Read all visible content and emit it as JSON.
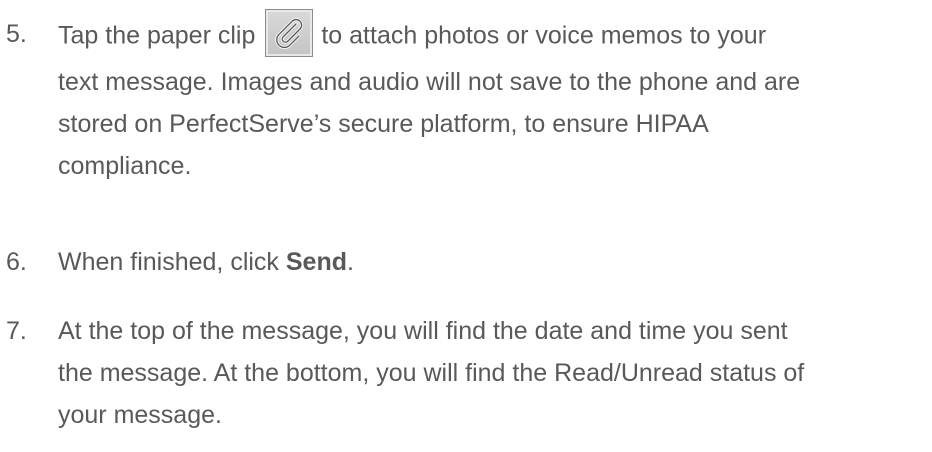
{
  "steps": [
    {
      "number": "5.",
      "pre_icon": "Tap the paper clip",
      "icon": "paperclip-icon",
      "post_icon": "to attach photos or voice memos to your",
      "lines": [
        "text message. Images and audio will not save to the phone and are",
        "stored on PerfectServe’s secure platform, to ensure HIPAA",
        "compliance."
      ]
    },
    {
      "number": "6.",
      "text_before": "When finished, click ",
      "bold": "Send",
      "text_after": "."
    },
    {
      "number": "7.",
      "lines": [
        "At the top of the message, you will find the date and time you sent",
        "the message. At the bottom, you will find the Read/Unread status of",
        "your message."
      ]
    }
  ]
}
